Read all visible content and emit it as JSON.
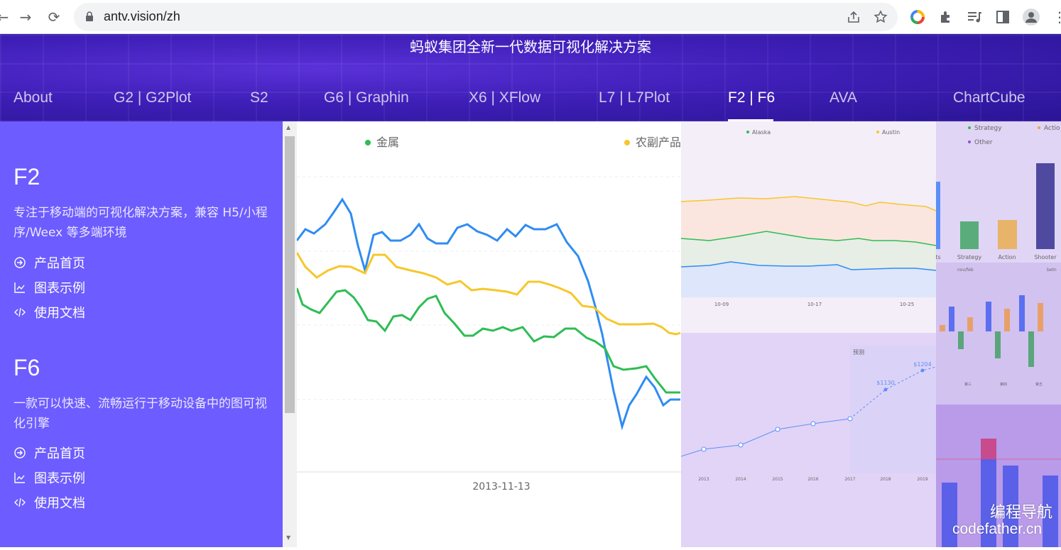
{
  "browser": {
    "url": "antv.vision/zh",
    "back_icon": "back-arrow-icon",
    "forward_icon": "forward-arrow-icon",
    "reload_icon": "reload-icon"
  },
  "hero": {
    "title": "蚂蚁集团全新一代数据可视化解决方案",
    "tabs": [
      {
        "label": "About"
      },
      {
        "label": "G2 | G2Plot"
      },
      {
        "label": "S2"
      },
      {
        "label": "G6 | Graphin"
      },
      {
        "label": "X6 | XFlow"
      },
      {
        "label": "L7 | L7Plot"
      },
      {
        "label": "F2 | F6",
        "active": true
      },
      {
        "label": "AVA"
      },
      {
        "label": "ChartCube"
      }
    ]
  },
  "sidebar": {
    "sections": [
      {
        "title": "F2",
        "desc": "专注于移动端的可视化解决方案，兼容 H5/小程序/Weex 等多端环境",
        "links": [
          "产品首页",
          "图表示例",
          "使用文档"
        ]
      },
      {
        "title": "F6",
        "desc": "一款可以快速、流畅运行于移动设备中的图可视化引擎",
        "links": [
          "产品首页",
          "图表示例",
          "使用文档"
        ]
      }
    ]
  },
  "main_chart": {
    "legend": [
      {
        "name": "金属",
        "color": "#2dbd53"
      },
      {
        "name": "农副产品",
        "color": "#f7c72a"
      }
    ],
    "x_label": "2013-11-13",
    "blue_color": "#2f8cf2"
  },
  "thumbs": {
    "area_legend": [
      "Alaska",
      "Austin"
    ],
    "area_ticks": [
      "10-09",
      "10-17",
      "10-25"
    ],
    "bar_legend": [
      "Strategy",
      "Actio",
      "Other"
    ],
    "bar_ticks": [
      "ts",
      "Strategy",
      "Action",
      "Shooter"
    ],
    "trend_label": "预测",
    "trend_values": [
      "$1130",
      "$1204"
    ],
    "trend_years": [
      "2013",
      "2014",
      "2015",
      "2016",
      "2017",
      "2018",
      "2019"
    ],
    "grouped_legend": [
      "nov/feb",
      "betn"
    ],
    "grouped_ticks": [
      "第三",
      "第四",
      "第五"
    ]
  },
  "watermark": {
    "line1": "编程导航",
    "line2": "codefather.cn"
  }
}
